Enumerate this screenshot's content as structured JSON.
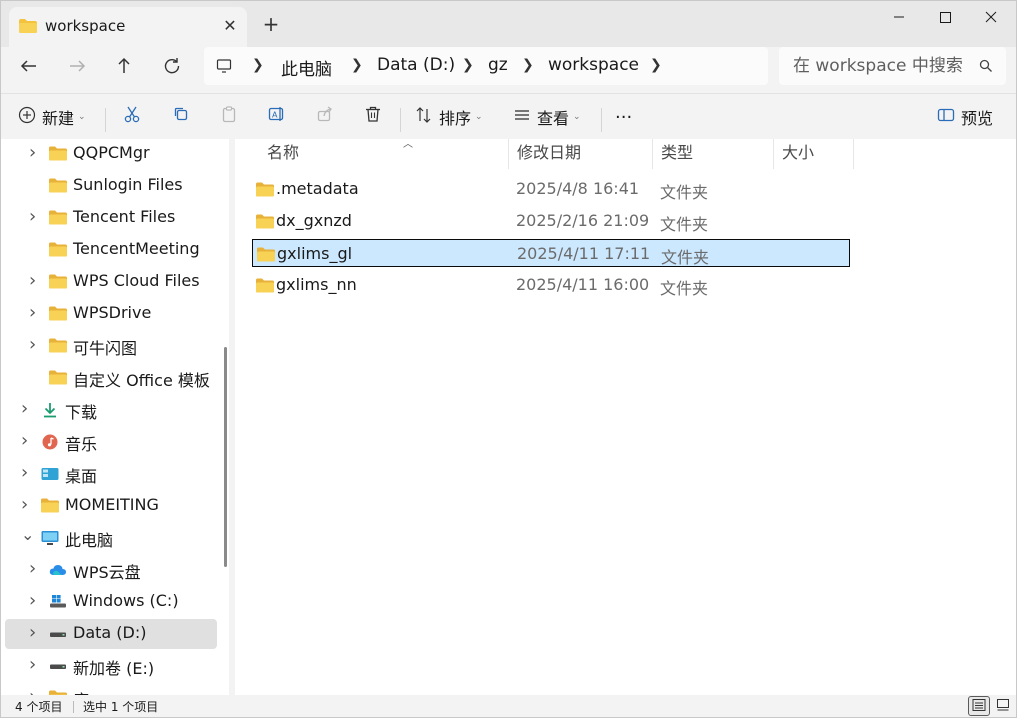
{
  "window": {
    "tab_title": "workspace",
    "new_tab_symbol": "+",
    "controls": [
      "minimize",
      "maximize",
      "close"
    ]
  },
  "address": {
    "root_icon": "computer-icon",
    "crumbs": [
      "此电脑",
      "Data (D:)",
      "gz",
      "workspace"
    ]
  },
  "search": {
    "placeholder": "在 workspace 中搜索"
  },
  "toolbar": {
    "new_label": "新建",
    "sort_label": "排序",
    "view_label": "查看",
    "more_label": "···",
    "preview_label": "预览"
  },
  "nav": {
    "items": [
      {
        "label": "QQPCMgr",
        "icon": "folder-icon",
        "chevron": true
      },
      {
        "label": "Sunlogin Files",
        "icon": "folder-icon",
        "chevron": false
      },
      {
        "label": "Tencent Files",
        "icon": "folder-icon",
        "chevron": true
      },
      {
        "label": "TencentMeeting",
        "icon": "folder-icon",
        "chevron": false
      },
      {
        "label": "WPS Cloud Files",
        "icon": "folder-icon",
        "chevron": true
      },
      {
        "label": "WPSDrive",
        "icon": "folder-icon",
        "chevron": true
      },
      {
        "label": "可牛闪图",
        "icon": "folder-icon",
        "chevron": true
      },
      {
        "label": "自定义 Office 模板",
        "icon": "folder-icon",
        "chevron": false
      },
      {
        "label": "下载",
        "icon": "download-icon",
        "chevron": true
      },
      {
        "label": "音乐",
        "icon": "music-icon",
        "chevron": true
      },
      {
        "label": "桌面",
        "icon": "desktop-icon",
        "chevron": true
      },
      {
        "label": "MOMEITING",
        "icon": "folder-icon",
        "chevron": true
      },
      {
        "label": "此电脑",
        "icon": "computer-icon",
        "chevron": true,
        "expanded": true
      },
      {
        "label": "WPS云盘",
        "icon": "cloud-icon",
        "chevron": true
      },
      {
        "label": "Windows (C:)",
        "icon": "windows-drive-icon",
        "chevron": true
      },
      {
        "label": "Data (D:)",
        "icon": "drive-icon",
        "chevron": true,
        "selected": true
      },
      {
        "label": "新加卷 (E:)",
        "icon": "drive-icon",
        "chevron": true
      },
      {
        "label": "库",
        "icon": "folder-icon",
        "chevron": true
      }
    ]
  },
  "columns": {
    "name": "名称",
    "modified": "修改日期",
    "type": "类型",
    "size": "大小"
  },
  "files": [
    {
      "name": ".metadata",
      "modified": "2025/4/8 16:41",
      "type": "文件夹",
      "selected": false
    },
    {
      "name": "dx_gxnzd",
      "modified": "2025/2/16 21:09",
      "type": "文件夹",
      "selected": false
    },
    {
      "name": "gxlims_gl",
      "modified": "2025/4/11 17:11",
      "type": "文件夹",
      "selected": true
    },
    {
      "name": "gxlims_nn",
      "modified": "2025/4/11 16:00",
      "type": "文件夹",
      "selected": false
    }
  ],
  "status": {
    "item_count": "4 个项目",
    "selected_count": "选中 1 个项目"
  },
  "colors": {
    "folder": "#f3c33e",
    "selection": "#cce8ff",
    "accent": "#0067c0"
  }
}
